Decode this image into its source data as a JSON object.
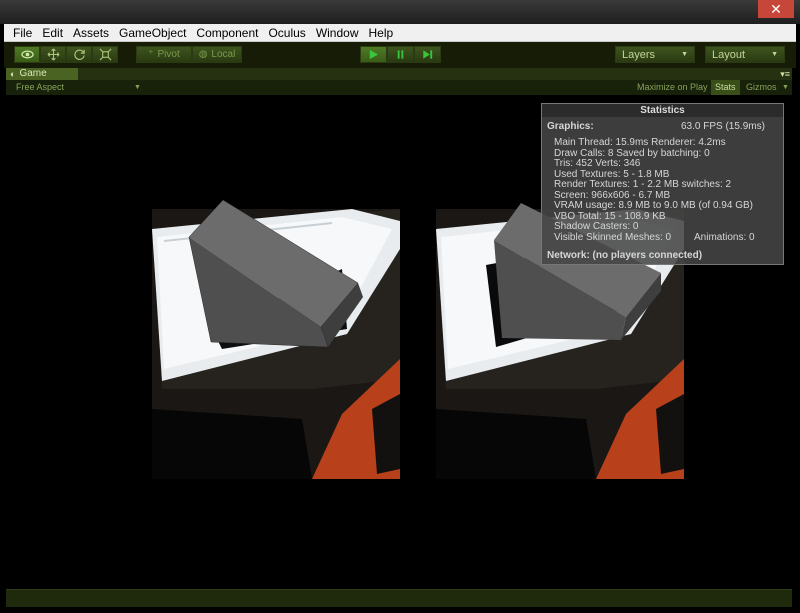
{
  "window": {
    "close_glyph": "✕"
  },
  "menu": [
    "File",
    "Edit",
    "Assets",
    "GameObject",
    "Component",
    "Oculus",
    "Window",
    "Help"
  ],
  "toolbar": {
    "pivot_label": "Pivot",
    "local_label": "Local",
    "layers_label": "Layers",
    "layout_label": "Layout"
  },
  "game_view": {
    "tab_label": "Game",
    "aspect_label": "Free Aspect",
    "maximize_label": "Maximize on Play",
    "stats_label": "Stats",
    "gizmos_label": "Gizmos"
  },
  "stats": {
    "title": "Statistics",
    "graphics_label": "Graphics:",
    "fps": "63.0 FPS (15.9ms)",
    "lines": [
      "Main Thread: 15.9ms  Renderer: 4.2ms",
      "Draw Calls: 8   Saved by batching: 0",
      "Tris: 452  Verts: 346",
      "Used Textures: 5 - 1.8 MB",
      "Render Textures: 1 - 2.2 MB  switches: 2",
      "Screen: 966x606 - 6.7 MB",
      "VRAM usage: 8.9 MB to 9.0 MB (of 0.94 GB)",
      "VBO Total: 15 - 108.9 KB",
      "Shadow Casters: 0"
    ],
    "skinned_label": "Visible Skinned Meshes: 0",
    "animations_label": "Animations: 0",
    "network_label": "Network: (no players connected)"
  },
  "colors": {
    "accent": "#4f7a25",
    "toolbar_bg": "#161c06",
    "stats_bg": "#464646"
  }
}
